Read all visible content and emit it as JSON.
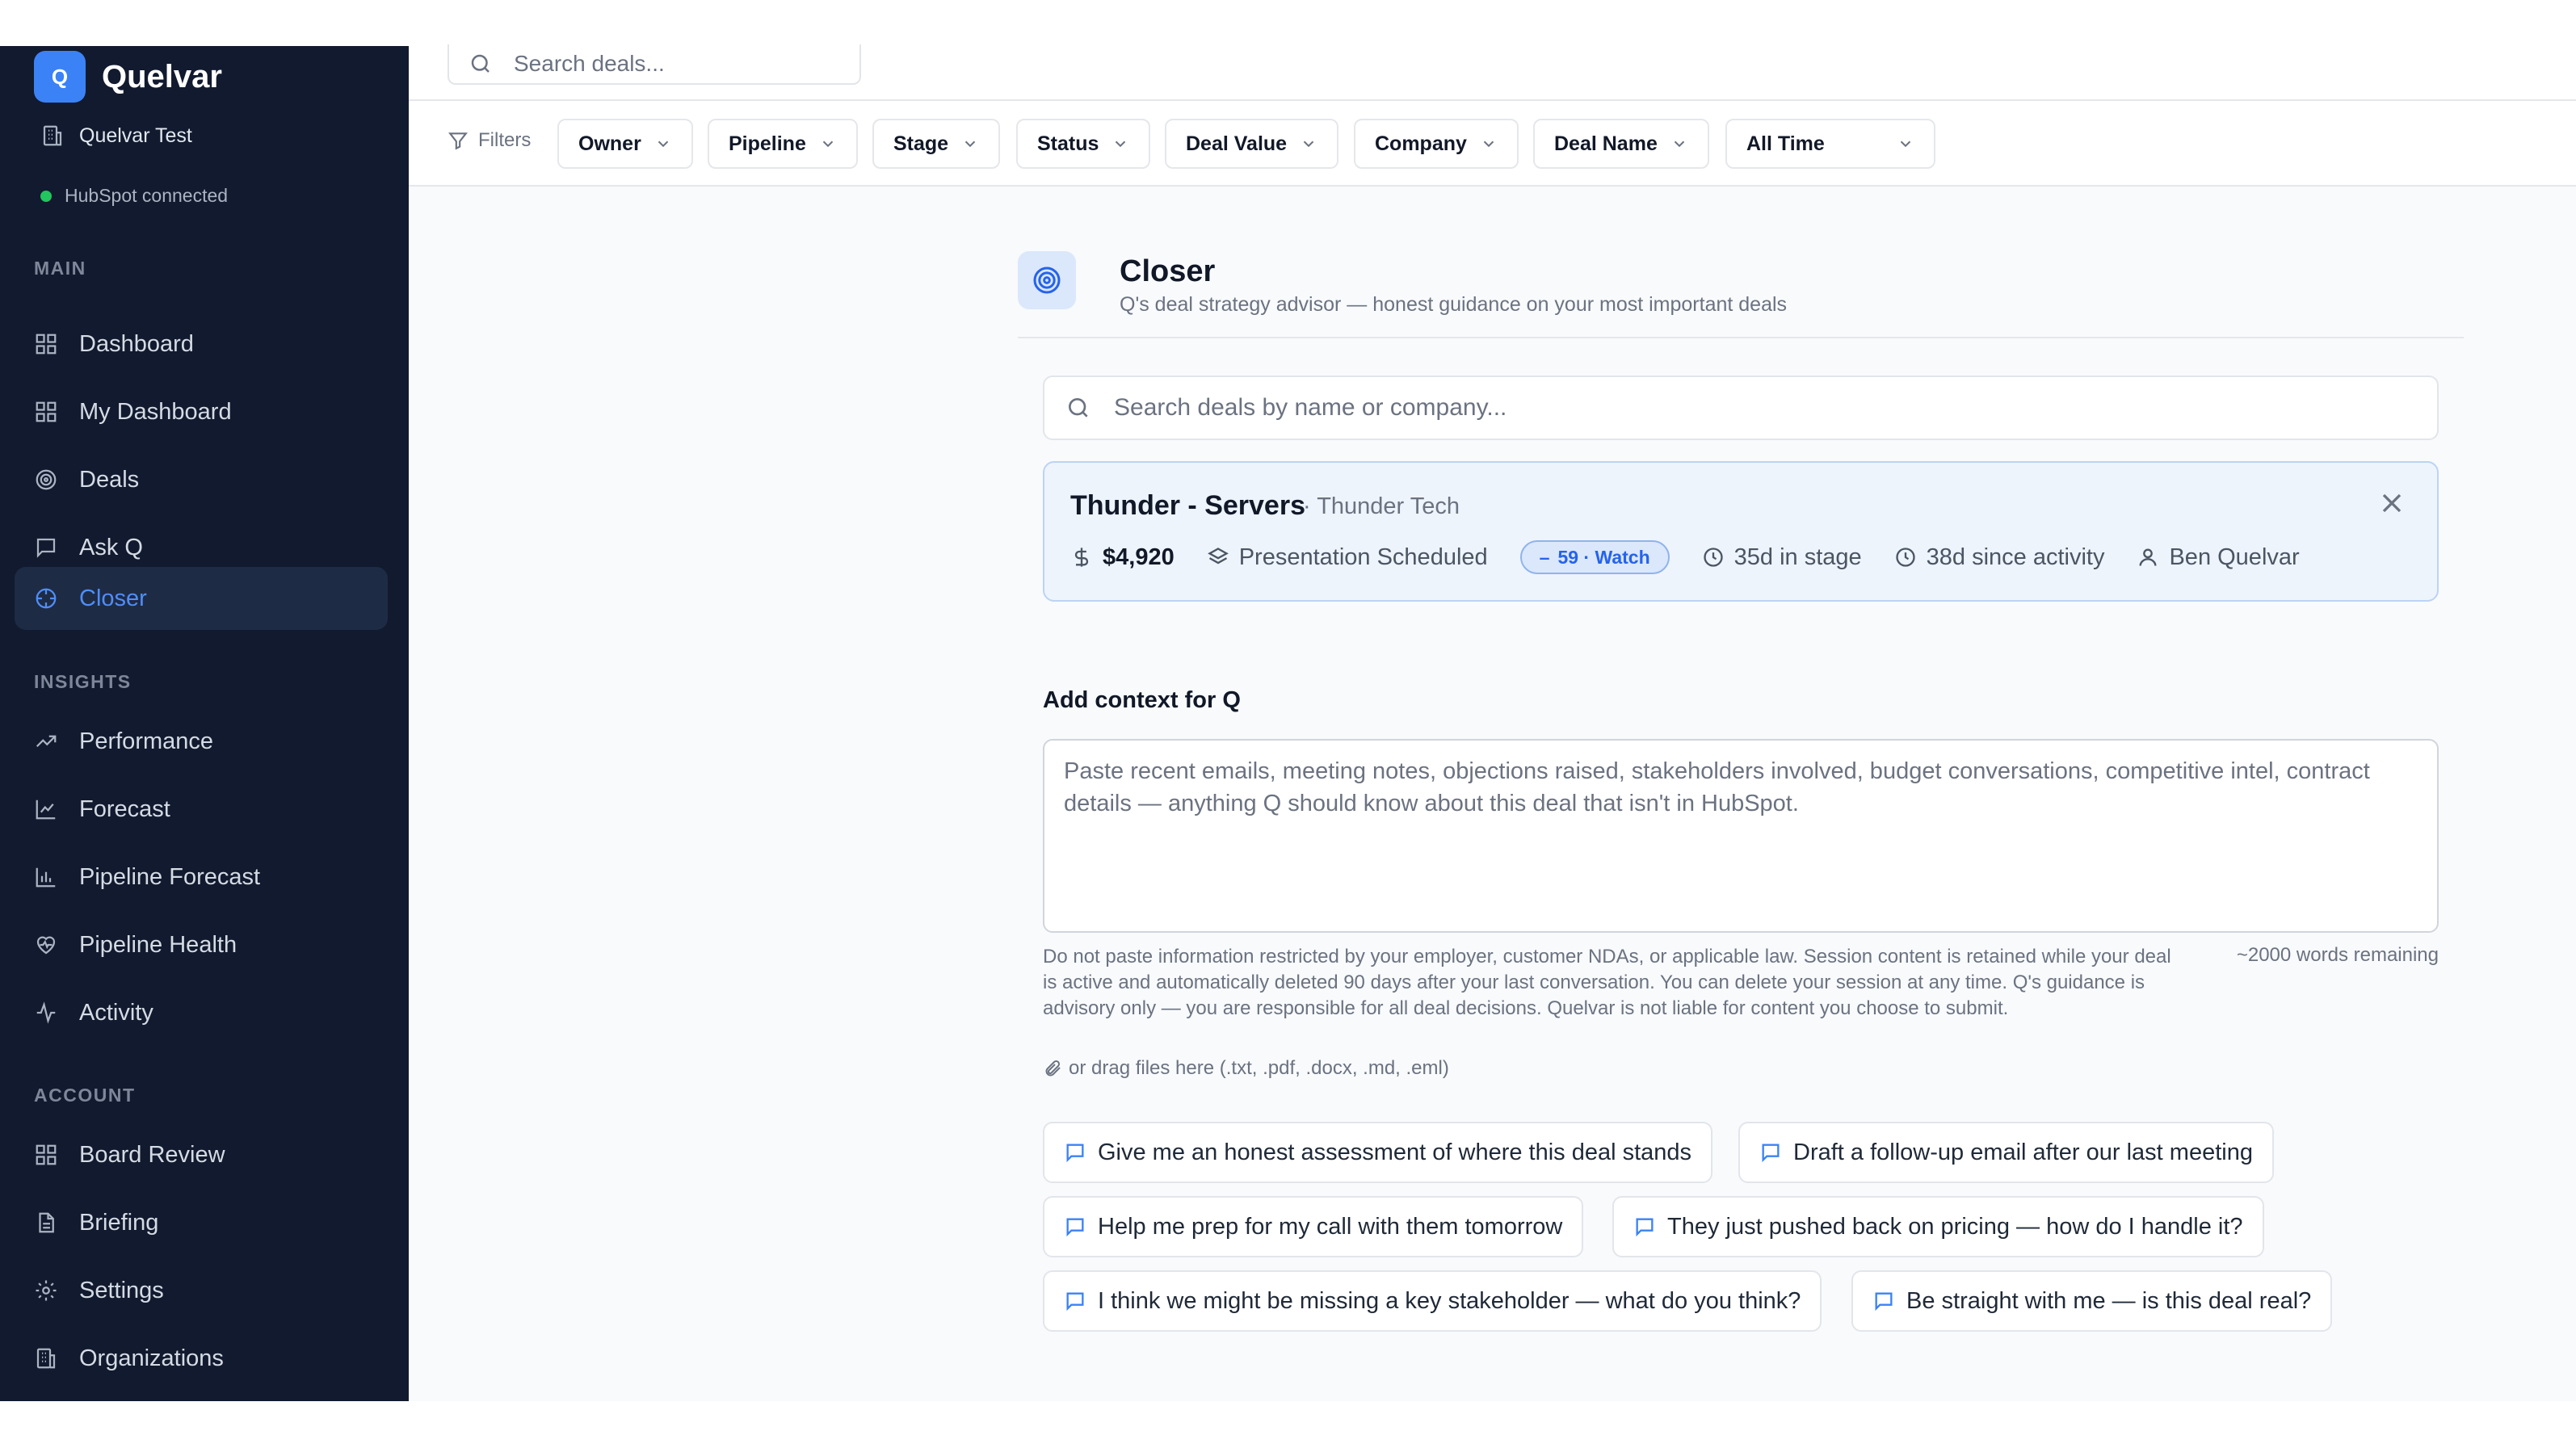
{
  "brand": {
    "logo_letter": "Q",
    "name": "Quelvar"
  },
  "org": {
    "name": "Quelvar Test"
  },
  "integration": {
    "status": "HubSpot connected",
    "status_color": "#22c55e"
  },
  "sidebar": {
    "sections": [
      {
        "label": "MAIN"
      },
      {
        "label": "INSIGHTS"
      },
      {
        "label": "ACCOUNT"
      }
    ],
    "items": [
      {
        "label": "Dashboard",
        "icon": "grid-icon"
      },
      {
        "label": "My Dashboard",
        "icon": "grid-icon"
      },
      {
        "label": "Deals",
        "icon": "target-icon"
      },
      {
        "label": "Ask Q",
        "icon": "chat-icon"
      },
      {
        "label": "Closer",
        "icon": "crosshair-icon",
        "active": true
      },
      {
        "label": "Performance",
        "icon": "trending-up-icon"
      },
      {
        "label": "Forecast",
        "icon": "line-chart-icon"
      },
      {
        "label": "Pipeline Forecast",
        "icon": "bar-chart-icon"
      },
      {
        "label": "Pipeline Health",
        "icon": "heart-pulse-icon"
      },
      {
        "label": "Activity",
        "icon": "activity-icon"
      },
      {
        "label": "Board Review",
        "icon": "grid-icon"
      },
      {
        "label": "Briefing",
        "icon": "document-icon"
      },
      {
        "label": "Settings",
        "icon": "gear-icon"
      },
      {
        "label": "Organizations",
        "icon": "building-icon"
      }
    ]
  },
  "topbar": {
    "search_placeholder": "Search deals..."
  },
  "filters": {
    "label": "Filters",
    "buttons": [
      "Owner",
      "Pipeline",
      "Stage",
      "Status",
      "Deal Value",
      "Company",
      "Deal Name",
      "All Time"
    ]
  },
  "closer": {
    "title": "Closer",
    "subtitle": "Q's deal strategy advisor — honest guidance on your most important deals",
    "search_placeholder": "Search deals by name or company..."
  },
  "deal": {
    "name": "Thunder - Servers",
    "company": "· Thunder Tech",
    "value": "$4,920",
    "stage": "Presentation Scheduled",
    "badge": "59 · Watch",
    "in_stage": "35d in stage",
    "since_activity": "38d since activity",
    "owner": "Ben Quelvar"
  },
  "context": {
    "label": "Add context for Q",
    "placeholder": "Paste recent emails, meeting notes, objections raised, stakeholders involved, budget conversations, competitive intel, contract details — anything Q should know about this deal that isn't in HubSpot.",
    "disclaimer": "Do not paste information restricted by your employer, customer NDAs, or applicable law. Session content is retained while your deal is active and automatically deleted 90 days after your last conversation. You can delete your session at any time. Q's guidance is advisory only — you are responsible for all deal decisions. Quelvar is not liable for content you choose to submit.",
    "words_remaining": "~2000 words remaining",
    "attach_hint": "or drag files here (.txt, .pdf, .docx, .md, .eml)"
  },
  "prompts": [
    "Give me an honest assessment of where this deal stands",
    "Draft a follow-up email after our last meeting",
    "Help me prep for my call with them tomorrow",
    "They just pushed back on pricing — how do I handle it?",
    "I think we might be missing a key stakeholder — what do you think?",
    "Be straight with me — is this deal real?"
  ],
  "colors": {
    "sidebar_bg": "#111a2e",
    "accent": "#3b82f6",
    "active_text": "#4f8ef7"
  }
}
